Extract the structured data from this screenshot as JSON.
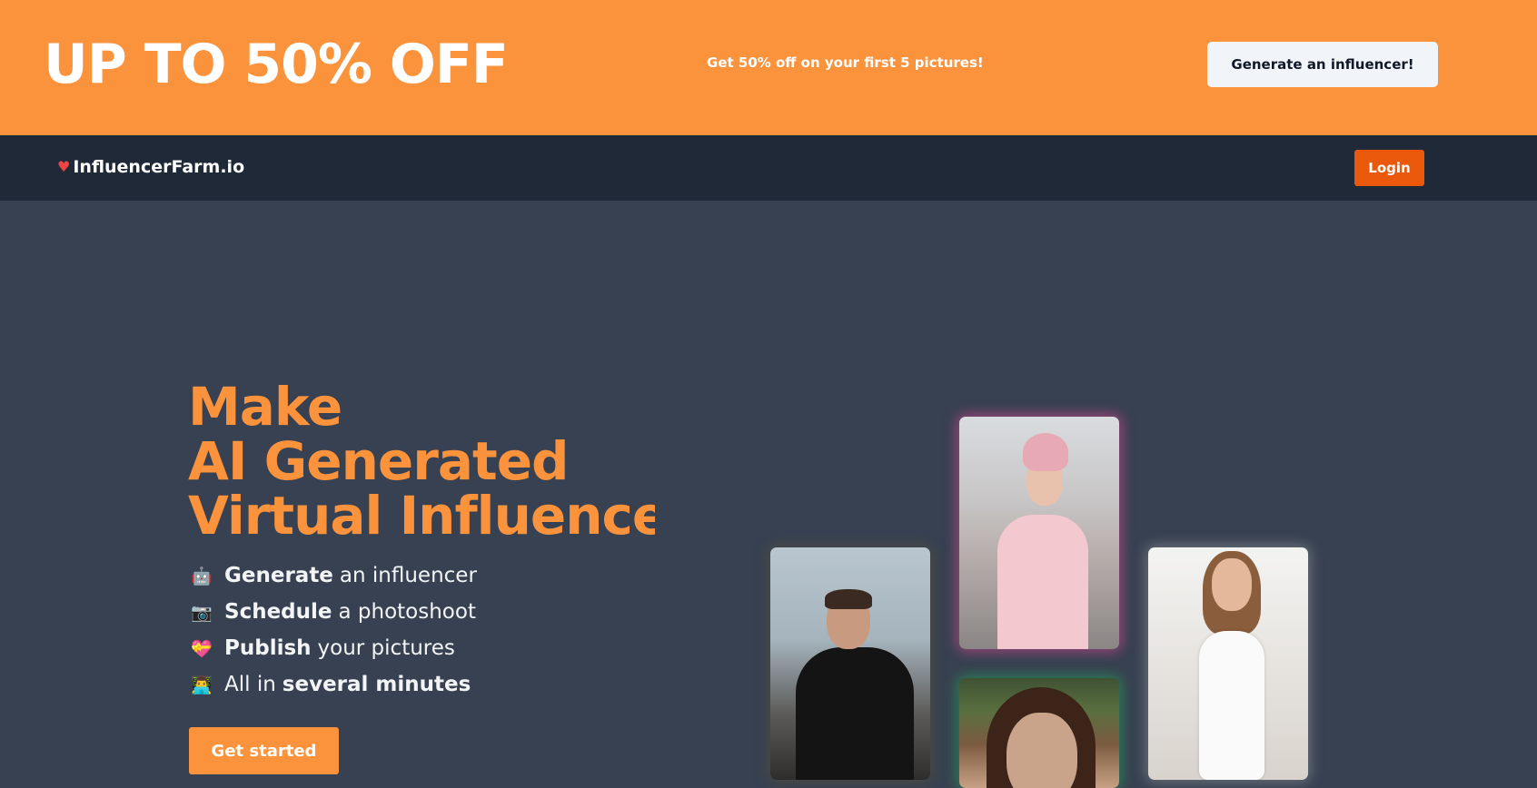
{
  "promo": {
    "headline": "UP TO 50% OFF",
    "subtext": "Get 50% off on your first 5 pictures!",
    "button_label": "Generate an influencer!"
  },
  "nav": {
    "brand_icon": "♥",
    "brand": "InfluencerFarm.io",
    "login_label": "Login"
  },
  "hero": {
    "title_lines": [
      "Make",
      "AI Generated",
      "Virtual Influencer"
    ],
    "features": [
      {
        "icon": "robot-icon",
        "emoji": "🤖",
        "bold": "Generate",
        "rest": "an influencer"
      },
      {
        "icon": "camera-icon",
        "emoji": "📷",
        "bold": "Schedule",
        "rest": "a photoshoot"
      },
      {
        "icon": "heart-icon",
        "emoji": "💝",
        "bold": "Publish",
        "rest": "your pictures"
      },
      {
        "icon": "technologist-icon",
        "emoji": "👨‍💻",
        "lead": "All in",
        "bold": "several minutes"
      }
    ],
    "cta_label": "Get started"
  },
  "colors": {
    "accent": "#fb923c",
    "login": "#ea580c",
    "nav_bg": "#1f2937",
    "page_bg": "#374151"
  }
}
